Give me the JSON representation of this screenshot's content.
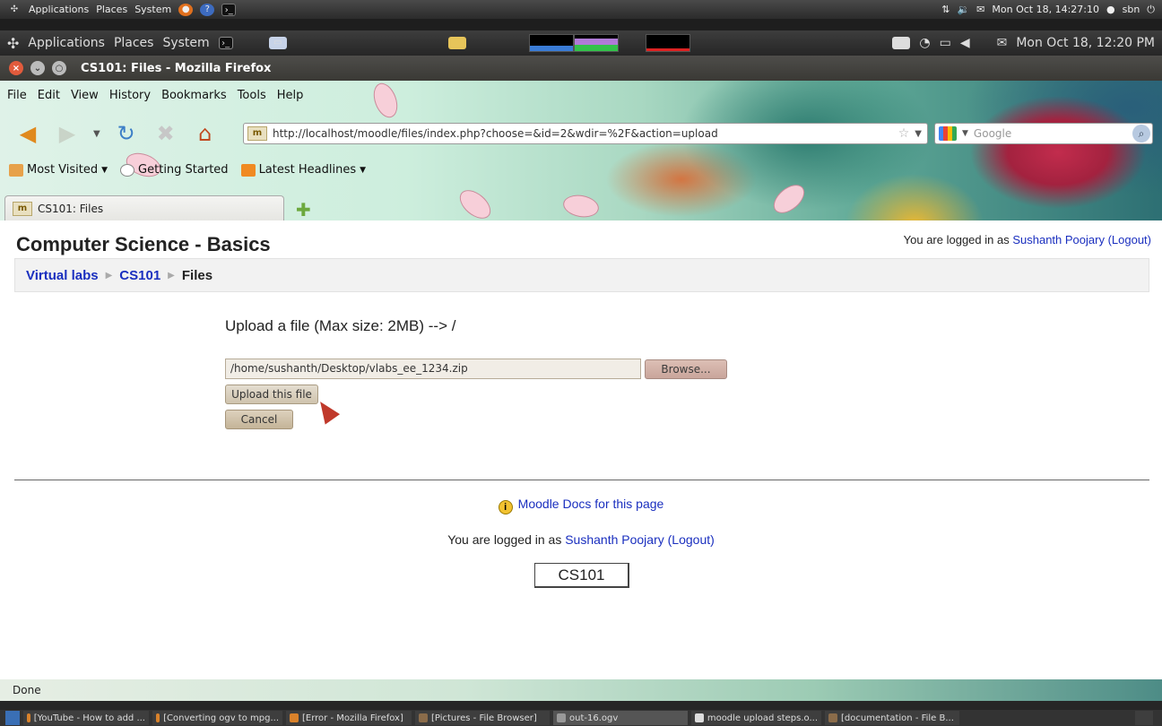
{
  "outer_panel": {
    "menus": [
      "Applications",
      "Places",
      "System"
    ],
    "clock": "Mon Oct 18, 14:27:10",
    "user": "sbn"
  },
  "inner_panel": {
    "menus": [
      "Applications",
      "Places",
      "System"
    ],
    "clock": "Mon Oct 18, 12:20 PM"
  },
  "window": {
    "title": "CS101: Files - Mozilla Firefox"
  },
  "menubar": [
    "File",
    "Edit",
    "View",
    "History",
    "Bookmarks",
    "Tools",
    "Help"
  ],
  "urlbar": {
    "site_icon": "m",
    "url": "http://localhost/moodle/files/index.php?choose=&id=2&wdir=%2F&action=upload"
  },
  "searchbar": {
    "placeholder": "Google"
  },
  "bookmarks": [
    "Most Visited",
    "Getting Started",
    "Latest Headlines"
  ],
  "tab": {
    "label": "CS101: Files"
  },
  "page": {
    "course_title": "Computer Science - Basics",
    "login_prefix": "You are logged in as ",
    "user_name": "Sushanth Poojary",
    "logout": "(Logout)",
    "breadcrumb": [
      "Virtual labs",
      "CS101",
      "Files"
    ],
    "upload_heading": "Upload a file (Max size: 2MB) --> /",
    "file_value": "/home/sushanth/Desktop/vlabs_ee_1234.zip",
    "browse_label": "Browse...",
    "upload_label": "Upload this file",
    "cancel_label": "Cancel",
    "docs_link": "Moodle Docs for this page",
    "course_short": "CS101"
  },
  "status": {
    "text": "Done"
  },
  "taskbar": [
    "[YouTube - How to add ...",
    "[Converting ogv to mpg...",
    "[Error - Mozilla Firefox]",
    "[Pictures - File Browser]",
    "out-16.ogv",
    "moodle upload steps.o...",
    "[documentation - File B..."
  ],
  "colors": {
    "link": "#1a2fbf",
    "panel": "#2b2b2b",
    "button": "#cfc3ad"
  }
}
